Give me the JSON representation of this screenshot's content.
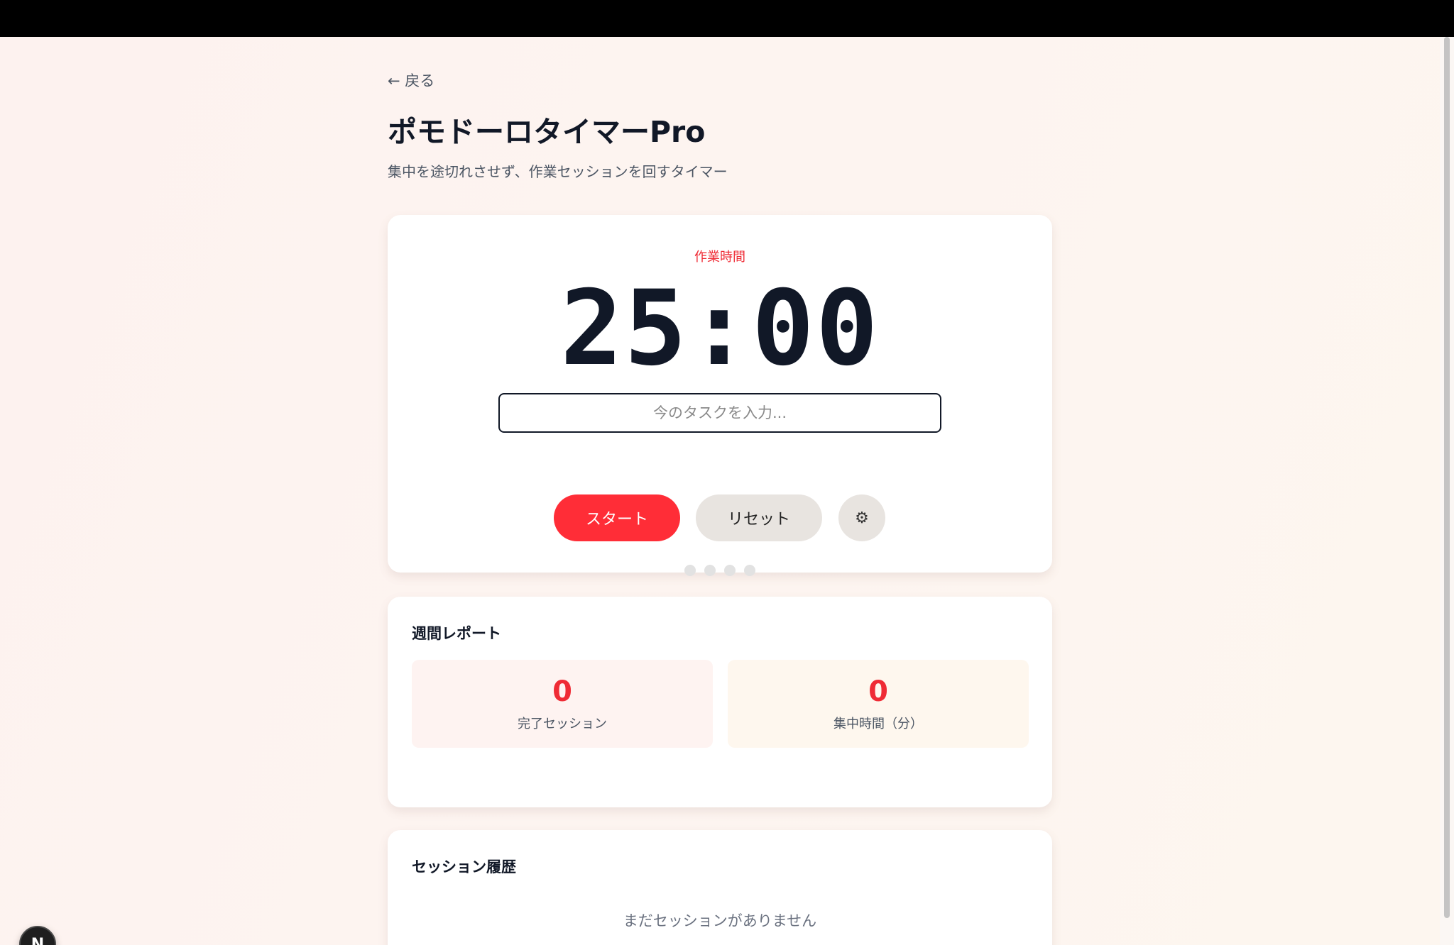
{
  "nav": {
    "back_label": "← 戻る"
  },
  "header": {
    "title": "ポモドーロタイマーPro",
    "subtitle": "集中を途切れさせず、作業セッションを回すタイマー"
  },
  "timer": {
    "mode_label": "作業時間",
    "display": "25:00",
    "task_placeholder": "今のタスクを入力...",
    "task_value": "",
    "start_label": "スタート",
    "reset_label": "リセット",
    "settings_icon": "⚙",
    "session_dots_total": 4,
    "session_dots_completed": 0
  },
  "weekly_report": {
    "heading": "週間レポート",
    "stats": [
      {
        "value": "0",
        "label": "完了セッション"
      },
      {
        "value": "0",
        "label": "集中時間（分）"
      }
    ]
  },
  "history": {
    "heading": "セッション履歴",
    "empty_message": "まだセッションがありません"
  },
  "badge": {
    "letter": "N"
  },
  "colors": {
    "accent": "#ff2d37",
    "text_primary": "#111827",
    "button_secondary": "#e8e4e0"
  }
}
